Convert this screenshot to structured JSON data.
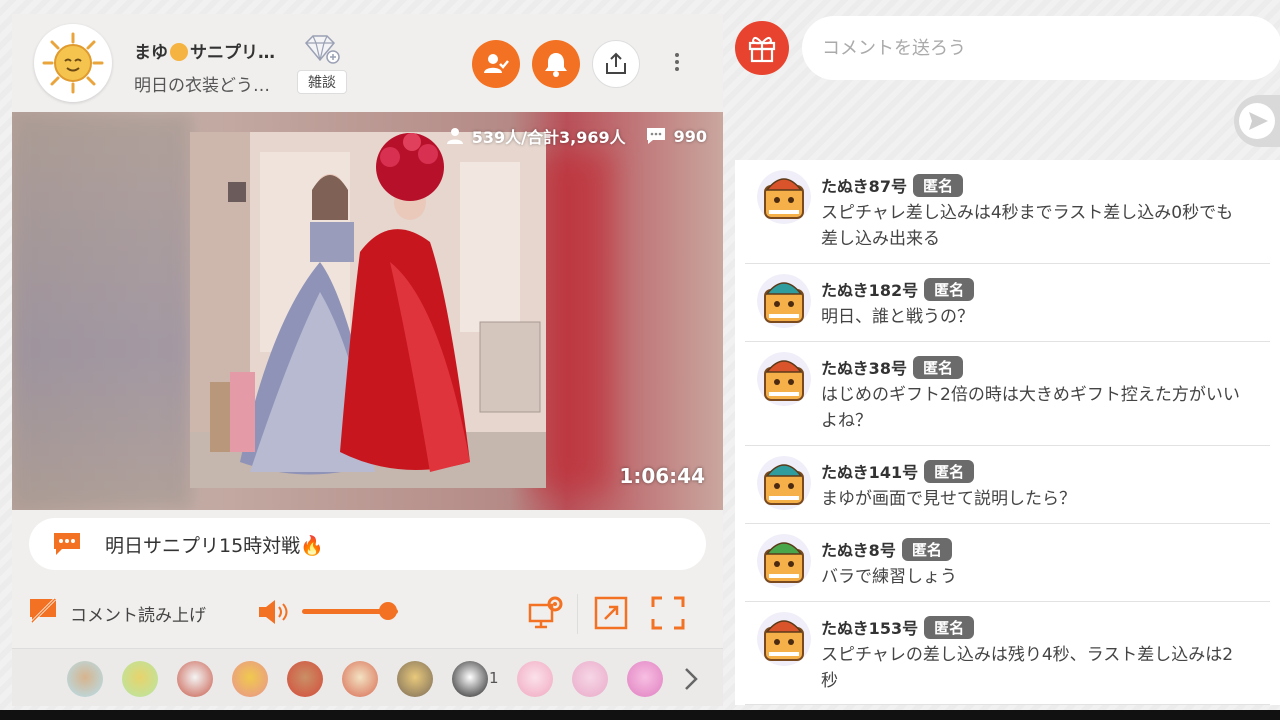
{
  "header": {
    "streamer_name": "まゆ",
    "streamer_name_suffix": "サニプリ…",
    "subtitle": "明日の衣装どう…",
    "genre": "雑談"
  },
  "video": {
    "viewers": "539人/合計3,969人",
    "comment_count": "990",
    "elapsed": "1:06:44"
  },
  "telop": {
    "text": "明日サニプリ15時対戦"
  },
  "controls": {
    "read_aloud_label": "コメント読み上げ",
    "volume_level": 0.9
  },
  "gift_bar": {
    "count": "1",
    "gifts": [
      "gift-1",
      "gift-2",
      "gift-3",
      "gift-4",
      "gift-5",
      "gift-6",
      "gift-7",
      "gift-8",
      "gift-9",
      "gift-10",
      "gift-11"
    ]
  },
  "comment_form": {
    "placeholder": "コメントを送ろう"
  },
  "comments": [
    {
      "name": "たぬき87号",
      "badge": "匿名",
      "text": "スピチャレ差し込みは4秒までラスト差し込み0秒でも差し込み出来る",
      "hat": "#d9532b"
    },
    {
      "name": "たぬき182号",
      "badge": "匿名",
      "text": "明日、誰と戦うの？",
      "hat": "#2f9c9e"
    },
    {
      "name": "たぬき38号",
      "badge": "匿名",
      "text": "はじめのギフト2倍の時は大きめギフト控えた方がいいよね？",
      "hat": "#d9532b"
    },
    {
      "name": "たぬき141号",
      "badge": "匿名",
      "text": "まゆが画面で見せて説明したら？",
      "hat": "#2f9c9e"
    },
    {
      "name": "たぬき8号",
      "badge": "匿名",
      "text": "バラで練習しょう",
      "hat": "#4aa64a"
    },
    {
      "name": "たぬき153号",
      "badge": "匿名",
      "text": "スピチャレの差し込みは残り4秒、ラスト差し込みは2秒",
      "hat": "#d9532b"
    }
  ],
  "colors": {
    "accent": "#f37122",
    "gift_button": "#e8432f",
    "badge": "#6b6b6b"
  }
}
